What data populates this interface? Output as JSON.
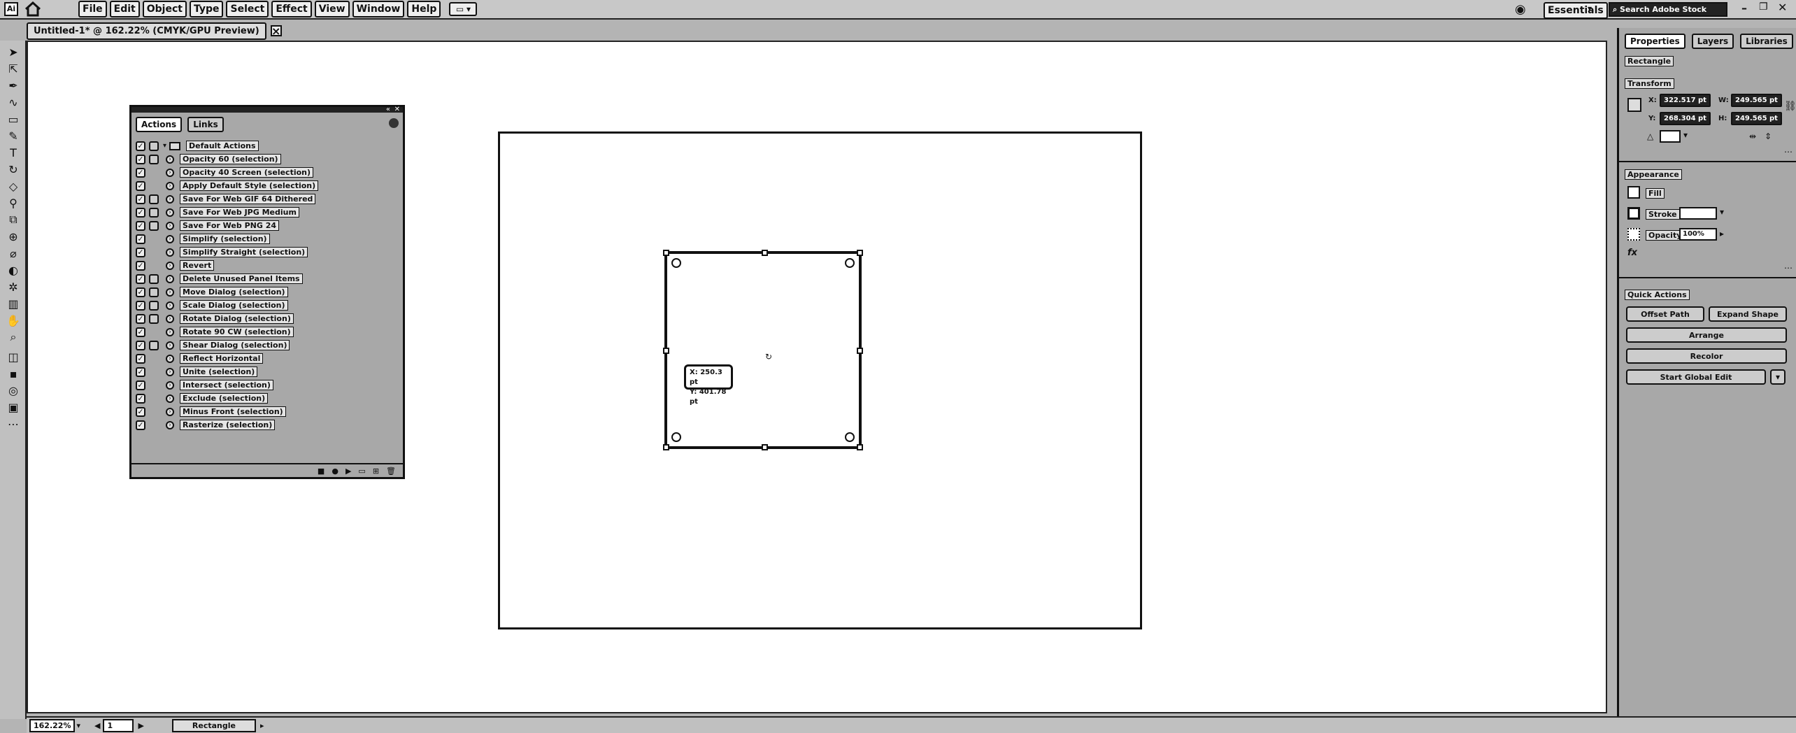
{
  "app": {
    "logo": "Ai",
    "menu": [
      "File",
      "Edit",
      "Object",
      "Type",
      "Select",
      "Effect",
      "View",
      "Window",
      "Help"
    ],
    "workspace": "Essentials",
    "search_placeholder": "Search Adobe Stock"
  },
  "document_tab": {
    "title": "Untitled-1* @ 162.22% (CMYK/GPU Preview)",
    "close_symbol": "×"
  },
  "actions_panel": {
    "tabs": [
      "Actions",
      "Links"
    ],
    "set_name": "Default Actions",
    "items": [
      {
        "label": "Opacity 60 (selection)",
        "dialog": true
      },
      {
        "label": "Opacity 40 Screen (selection)",
        "dialog": false
      },
      {
        "label": "Apply Default Style (selection)",
        "dialog": false
      },
      {
        "label": "Save For Web GIF 64 Dithered",
        "dialog": true
      },
      {
        "label": "Save For Web JPG Medium",
        "dialog": true
      },
      {
        "label": "Save For Web PNG 24",
        "dialog": true
      },
      {
        "label": "Simplify (selection)",
        "dialog": false
      },
      {
        "label": "Simplify Straight (selection)",
        "dialog": false
      },
      {
        "label": "Revert",
        "dialog": false
      },
      {
        "label": "Delete Unused Panel Items",
        "dialog": true
      },
      {
        "label": "Move Dialog (selection)",
        "dialog": true
      },
      {
        "label": "Scale Dialog (selection)",
        "dialog": true
      },
      {
        "label": "Rotate Dialog (selection)",
        "dialog": true
      },
      {
        "label": "Rotate 90 CW (selection)",
        "dialog": false
      },
      {
        "label": "Shear Dialog (selection)",
        "dialog": true
      },
      {
        "label": "Reflect Horizontal",
        "dialog": false
      },
      {
        "label": "Unite (selection)",
        "dialog": false
      },
      {
        "label": "Intersect (selection)",
        "dialog": false
      },
      {
        "label": "Exclude (selection)",
        "dialog": false
      },
      {
        "label": "Minus Front (selection)",
        "dialog": false
      },
      {
        "label": "Rasterize (selection)",
        "dialog": false
      }
    ]
  },
  "canvas": {
    "tooltip_x": "X: 250.3 pt",
    "tooltip_y": "Y: 401.78 pt"
  },
  "properties_panel": {
    "tabs": [
      "Properties",
      "Layers",
      "Libraries"
    ],
    "object_type": "Rectangle",
    "transform": {
      "title": "Transform",
      "x": "322.517 pt",
      "y": "268.304 pt",
      "w": "249.565 pt",
      "h": "249.565 pt",
      "x_label": "X:",
      "y_label": "Y:",
      "w_label": "W:",
      "h_label": "H:"
    },
    "appearance": {
      "title": "Appearance",
      "fill_label": "Fill",
      "stroke_label": "Stroke",
      "opacity_label": "Opacity",
      "opacity_value": "100%"
    },
    "quick_actions": {
      "title": "Quick Actions",
      "offset_path": "Offset Path",
      "expand_shape": "Expand Shape",
      "arrange": "Arrange",
      "recolor": "Recolor",
      "global_edit": "Start Global Edit"
    }
  },
  "status_bar": {
    "zoom": "162.22%",
    "artboard_number": "1",
    "selection_tool": "Rectangle"
  }
}
